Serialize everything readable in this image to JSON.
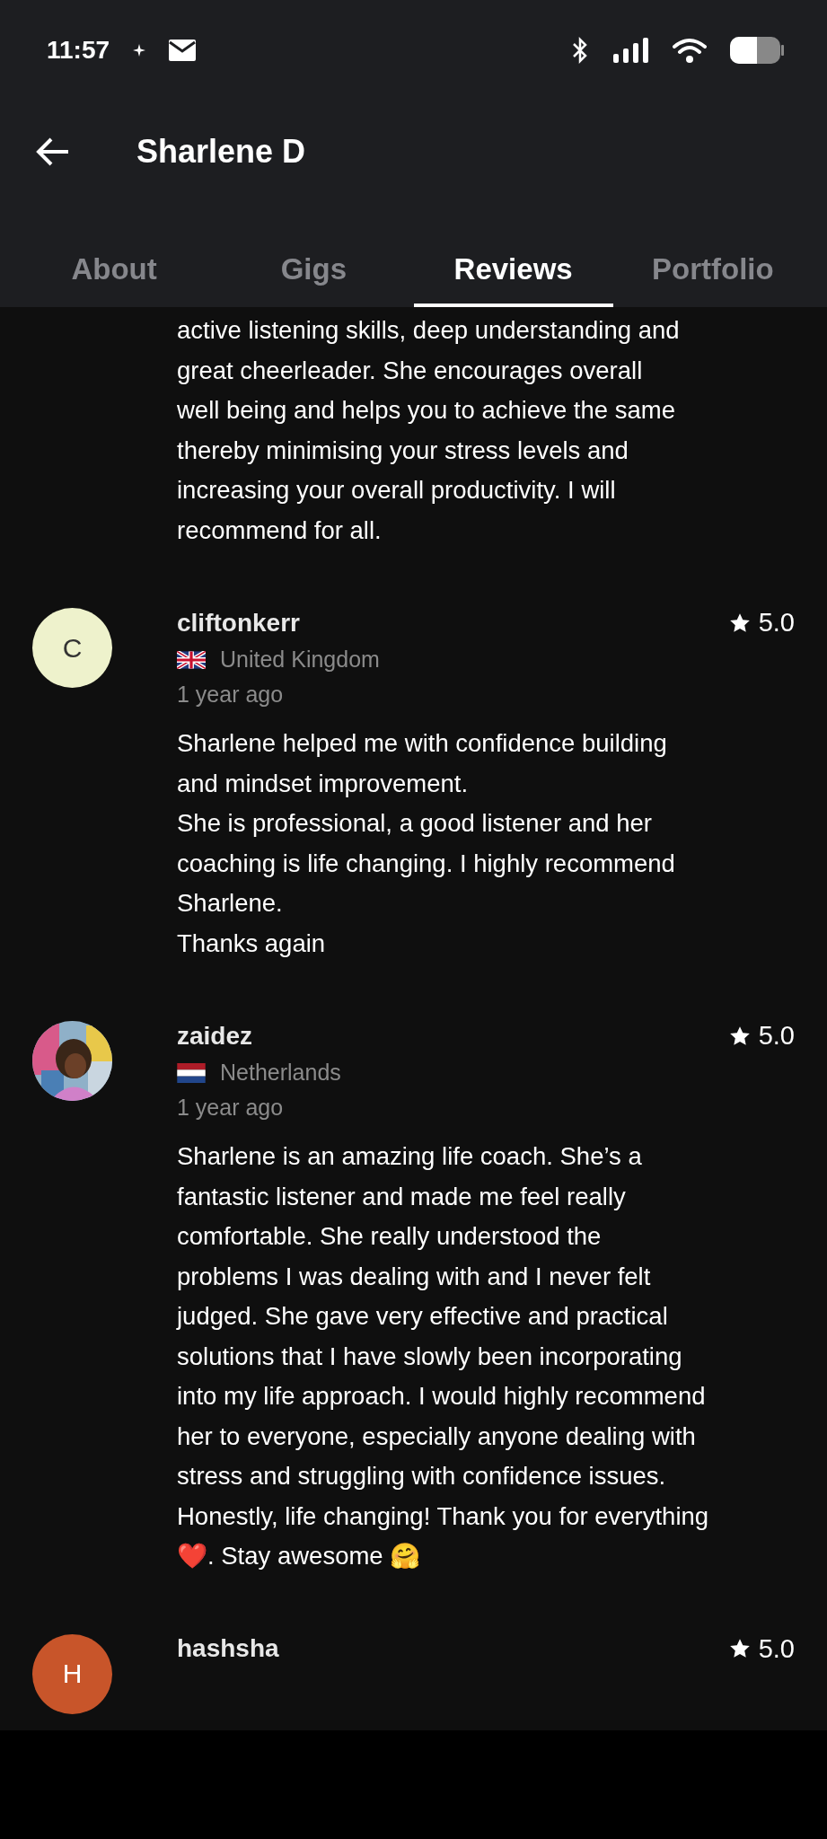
{
  "status_bar": {
    "time": "11:57"
  },
  "header": {
    "title": "Sharlene D"
  },
  "tabs": [
    {
      "label": "About",
      "selected": false
    },
    {
      "label": "Gigs",
      "selected": false
    },
    {
      "label": "Reviews",
      "selected": true
    },
    {
      "label": "Portfolio",
      "selected": false
    }
  ],
  "reviews": [
    {
      "text": "active listening skills, deep understanding and\ngreat cheerleader. She encourages overall\nwell being and helps you to achieve the same\nthereby minimising your stress levels and\nincreasing your overall productivity. I will\nrecommend for all."
    },
    {
      "avatar": {
        "kind": "letter",
        "letter": "C",
        "color": "#eef2cc"
      },
      "name": "cliftonkerr",
      "rating": "5.0",
      "flag": {
        "kind": "uk"
      },
      "country": "United Kingdom",
      "time": "1 year ago",
      "text": "Sharlene helped me with confidence building\nand mindset improvement.\nShe is professional, a good listener and her\ncoaching is life changing. I highly recommend\nSharlene.\nThanks again"
    },
    {
      "name": "zaidez",
      "rating": "5.0",
      "flag": {
        "kind": "nl"
      },
      "country": "Netherlands",
      "time": "1 year ago",
      "text": "Sharlene is an amazing life coach. She’s a\nfantastic listener and made me feel really\ncomfortable. She really understood the\nproblems I was dealing with and I never felt\njudged. She gave very effective and practical\nsolutions that I have slowly been incorporating\ninto my life approach. I would highly recommend\nher to everyone, especially anyone dealing with\nstress and struggling with confidence issues.\nHonestly, life changing! Thank you for everything\n❤️. Stay awesome 🤗"
    },
    {
      "avatar": {
        "kind": "letter",
        "letter": "H",
        "color": "#c8552a"
      },
      "name": "hashsha",
      "rating": "5.0"
    }
  ]
}
